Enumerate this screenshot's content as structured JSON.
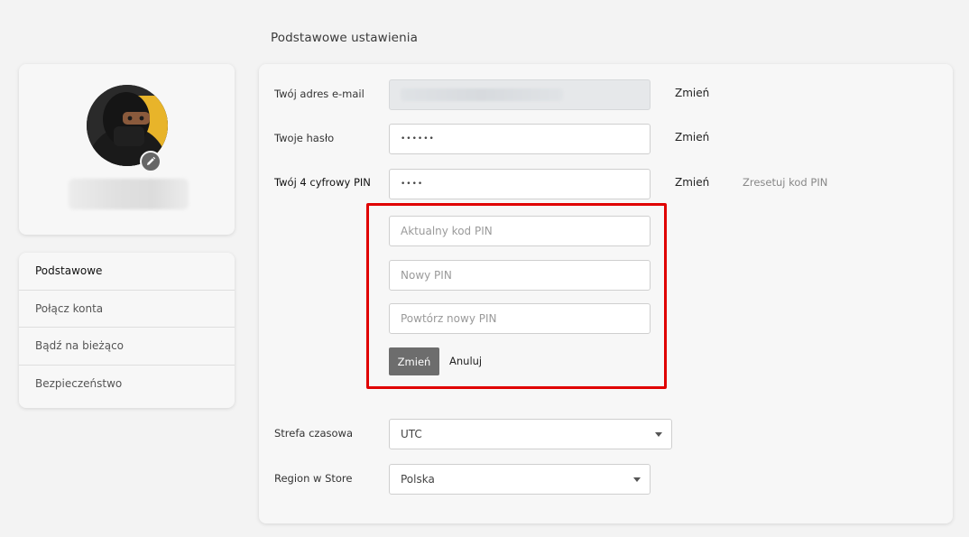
{
  "page": {
    "section_title": "Podstawowe ustawienia"
  },
  "profile": {
    "avatar_icon": "avatar-photo",
    "edit_icon": "pencil-icon"
  },
  "nav": {
    "items": [
      {
        "label": "Podstawowe",
        "active": true
      },
      {
        "label": "Połącz konta",
        "active": false
      },
      {
        "label": "Bądź na bieżąco",
        "active": false
      },
      {
        "label": "Bezpieczeństwo",
        "active": false
      }
    ]
  },
  "form": {
    "email": {
      "label": "Twój adres e-mail",
      "action": "Zmień"
    },
    "password": {
      "label": "Twoje hasło",
      "value": "••••••",
      "action": "Zmień"
    },
    "pin": {
      "label": "Twój 4 cyfrowy PIN",
      "value": "••••",
      "action": "Zmień",
      "reset": "Zresetuj kod PIN"
    },
    "pin_change": {
      "current_placeholder": "Aktualny kod PIN",
      "new_placeholder": "Nowy PIN",
      "repeat_placeholder": "Powtórz nowy PIN",
      "submit": "Zmień",
      "cancel": "Anuluj"
    },
    "timezone": {
      "label": "Strefa czasowa",
      "value": "UTC"
    },
    "region": {
      "label": "Region w Store",
      "value": "Polska"
    }
  },
  "colors": {
    "highlight": "#e00000",
    "button": "#6d6d6d",
    "background": "#f3f3f3"
  }
}
